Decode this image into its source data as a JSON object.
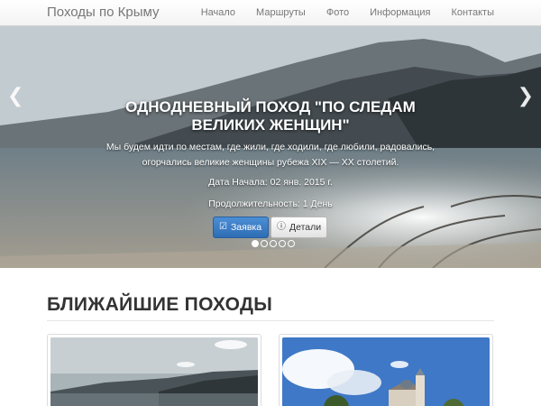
{
  "navbar": {
    "brand": "Походы по Крыму",
    "items": [
      "Начало",
      "Маршруты",
      "Фото",
      "Информация",
      "Контакты"
    ]
  },
  "hero": {
    "title": "Однодневный поход \"По следам великих женщин\"",
    "description": "Мы будем идти по местам, где жили, где ходили, где любили, радовались, огорчались великие женщины рубежа XIX — XX столетий.",
    "date": "Дата Начала: 02 янв. 2015 г.",
    "duration": "Продолжительность: 1 День",
    "apply_label": "Заявка",
    "details_label": "Детали",
    "slide_count": 5,
    "active_slide": 1
  },
  "section": {
    "title": "БЛИЖАЙШИЕ ПОХОДЫ"
  },
  "colors": {
    "primary": "#337ab7",
    "text": "#333333",
    "nav_text": "#777777"
  }
}
